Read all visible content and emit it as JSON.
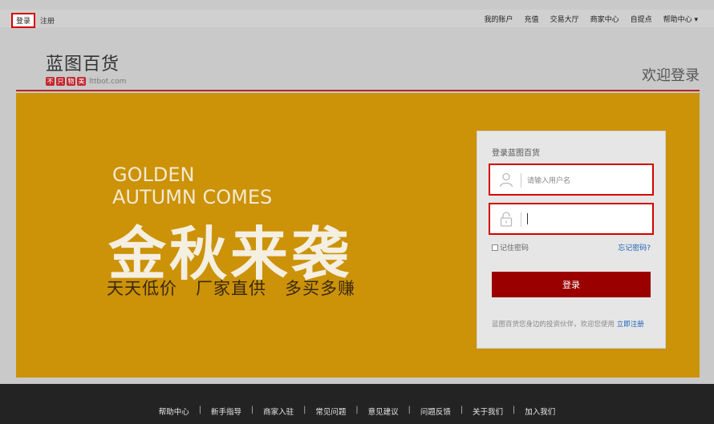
{
  "topbar": {
    "login": "登录",
    "register": "注册",
    "right": [
      "我的账户",
      "充值",
      "交易大厅",
      "商家中心",
      "自提点",
      "帮助中心 ▾"
    ]
  },
  "logo": {
    "name": "蓝图百货",
    "slogan": [
      "不",
      "只",
      "物",
      "美"
    ],
    "domain": "lttbot.com"
  },
  "welcome": "欢迎登录",
  "banner": {
    "en_line1": "GOLDEN",
    "en_line2": "AUTUMN COMES",
    "cn_title": "金秋来袭",
    "cn_sub": "天天低价   厂家直供   多买多赚"
  },
  "login_box": {
    "title": "登录蓝图百货",
    "username_placeholder": "请输入用户名",
    "password_value": "",
    "remember": "记住密码",
    "forgot": "忘记密码?",
    "submit": "登录",
    "bottom_text": "蓝图百货您身边的投资伙伴，欢迎您使用",
    "register_link": "立即注册"
  },
  "footer": {
    "links": [
      "帮助中心",
      "新手指导",
      "商家入驻",
      "常见问题",
      "意见建议",
      "问题反馈",
      "关于我们",
      "加入我们"
    ]
  },
  "colors": {
    "accent": "#9b0000",
    "banner": "#cc9208",
    "link": "#1a63b8"
  }
}
